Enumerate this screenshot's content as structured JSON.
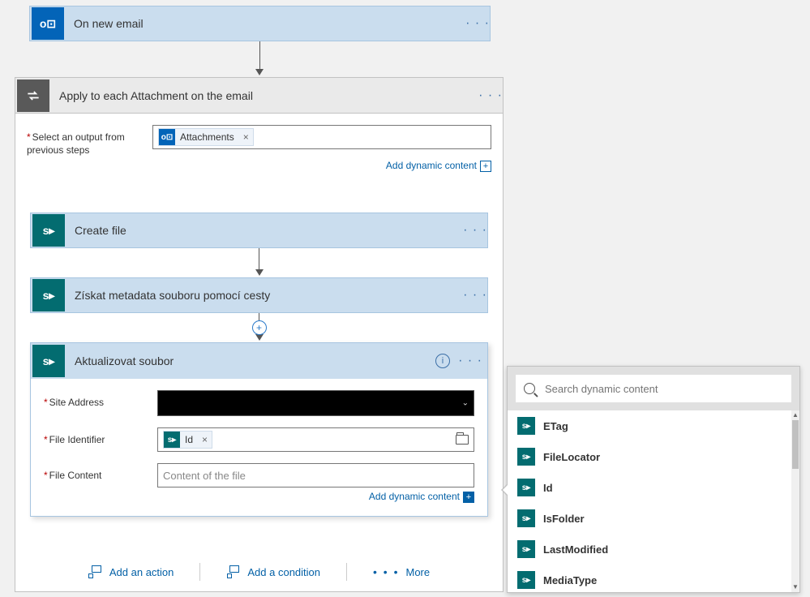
{
  "trigger": {
    "title": "On new email"
  },
  "apply_each": {
    "title": "Apply to each Attachment on the email",
    "select_label": "Select an output from previous steps",
    "token": "Attachments",
    "add_dynamic": "Add dynamic content"
  },
  "create_file": {
    "title": "Create file"
  },
  "get_meta": {
    "title": "Získat metadata souboru pomocí cesty"
  },
  "update_file": {
    "title": "Aktualizovat soubor",
    "site_label": "Site Address",
    "file_id_label": "File Identifier",
    "id_token": "Id",
    "content_label": "File Content",
    "content_placeholder": "Content of the file",
    "add_dynamic": "Add dynamic content"
  },
  "footer": {
    "add_action": "Add an action",
    "add_condition": "Add a condition",
    "more": "More"
  },
  "dyn": {
    "search_placeholder": "Search dynamic content",
    "items": [
      "ETag",
      "FileLocator",
      "Id",
      "IsFolder",
      "LastModified",
      "MediaType"
    ]
  }
}
